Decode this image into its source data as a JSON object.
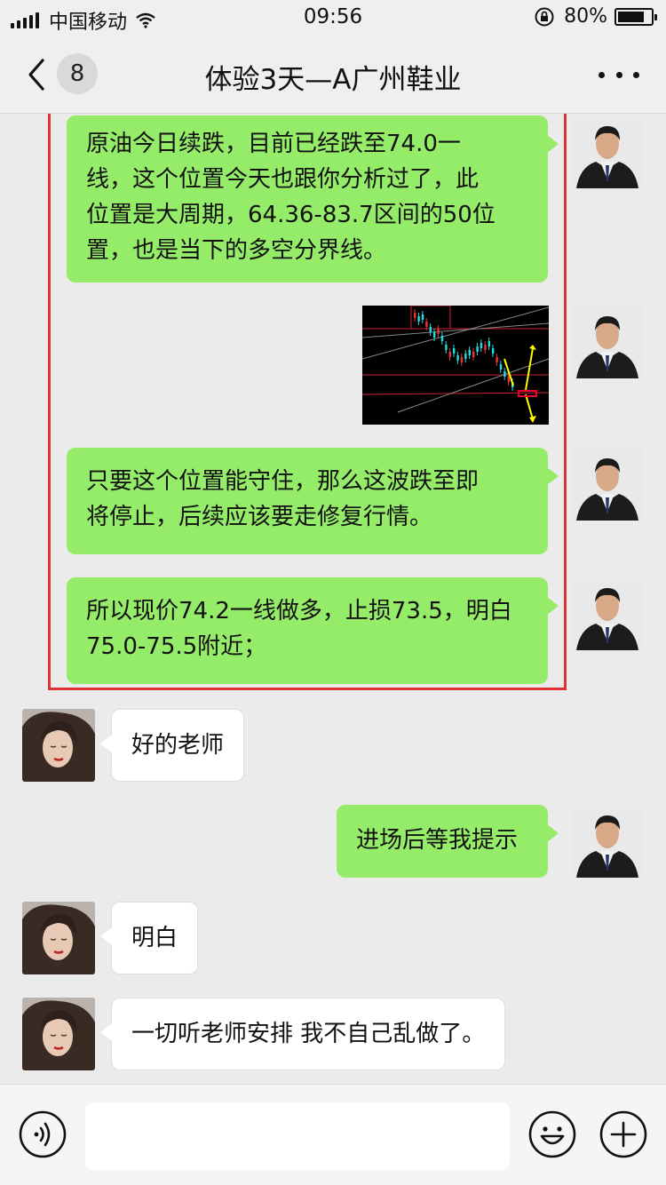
{
  "status_bar": {
    "carrier": "中国移动",
    "time": "09:56",
    "battery_percent": "80%",
    "battery_level": 0.8
  },
  "nav": {
    "unread_count": "8",
    "title": "体验3天—A广州鞋业"
  },
  "messages": [
    {
      "sender": "teacher",
      "type": "text",
      "lines": [
        "原油今日续跌，目前已经跌至74.0一",
        "线，这个位置今天也跟你分析过了，此",
        "位置是大周期，64.36-83.7区间的50位",
        "置，也是当下的多空分界线。"
      ]
    },
    {
      "sender": "teacher",
      "type": "image",
      "icon": "candlestick-chart-image"
    },
    {
      "sender": "teacher",
      "type": "text",
      "lines": [
        "只要这个位置能守住，那么这波跌至即",
        "将停止，后续应该要走修复行情。"
      ]
    },
    {
      "sender": "teacher",
      "type": "text",
      "lines": [
        "所以现价74.2一线做多，止损73.5，明白",
        "75.0-75.5附近；"
      ]
    },
    {
      "sender": "student",
      "type": "text",
      "lines": [
        "好的老师"
      ]
    },
    {
      "sender": "teacher",
      "type": "text",
      "lines": [
        "进场后等我提示"
      ]
    },
    {
      "sender": "student",
      "type": "text",
      "lines": [
        "明白"
      ]
    },
    {
      "sender": "student",
      "type": "text",
      "lines": [
        "一切听老师安排 我不自己乱做了。"
      ]
    }
  ],
  "input": {
    "value": "",
    "placeholder": ""
  },
  "colors": {
    "outgoing_bubble": "#95ec69",
    "incoming_bubble": "#ffffff",
    "highlight_border": "#e03135",
    "chat_background": "#ebebeb"
  },
  "icons": [
    "signal-icon",
    "wifi-icon",
    "rotation-lock-icon",
    "battery-icon",
    "back-chevron-icon",
    "more-dots-icon",
    "voice-icon",
    "emoji-icon",
    "plus-icon"
  ]
}
